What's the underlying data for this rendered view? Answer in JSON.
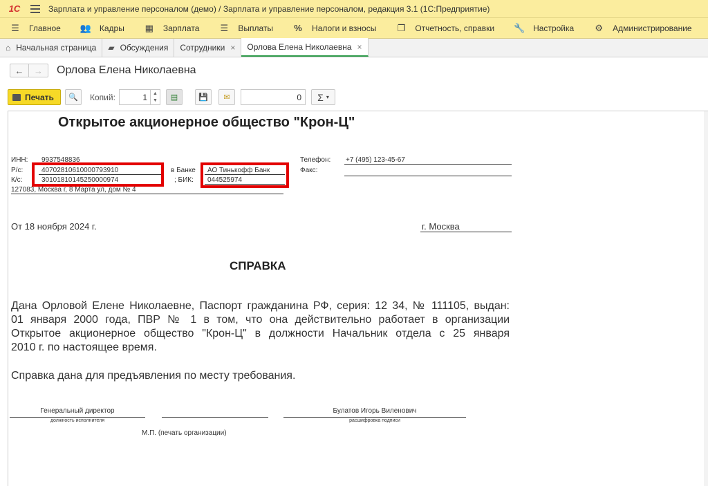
{
  "titlebar": {
    "logo": "1С",
    "title": "Зарплата и управление персоналом (демо) / Зарплата и управление персоналом, редакция 3.1  (1С:Предприятие)"
  },
  "menu": [
    {
      "label": "Главное",
      "icon": "hamburger-icon"
    },
    {
      "label": "Кадры",
      "icon": "people-icon"
    },
    {
      "label": "Зарплата",
      "icon": "calculator-icon"
    },
    {
      "label": "Выплаты",
      "icon": "list-icon"
    },
    {
      "label": "Налоги и взносы",
      "icon": "percent-icon"
    },
    {
      "label": "Отчетность, справки",
      "icon": "documents-icon"
    },
    {
      "label": "Настройка",
      "icon": "wrench-icon"
    },
    {
      "label": "Администрирование",
      "icon": "gear-icon"
    }
  ],
  "tabs": [
    {
      "label": "Начальная страница",
      "icon": "home-icon",
      "closable": false
    },
    {
      "label": "Обсуждения",
      "icon": "chat-icon",
      "closable": false
    },
    {
      "label": "Сотрудники",
      "closable": true
    },
    {
      "label": "Орлова Елена Николаевна",
      "closable": true,
      "active": true
    }
  ],
  "header": {
    "back": "←",
    "forward": "→",
    "title": "Орлова Елена Николаевна"
  },
  "toolbar": {
    "print_label": "Печать",
    "copies_label": "Копий:",
    "copies_value": "1",
    "sum_value": "0",
    "sum_symbol": "Σ",
    "sum_arrow": "▾"
  },
  "doc": {
    "org_title": "Открытое акционерное общество \"Крон-Ц\"",
    "inn_label": "ИНН:",
    "inn": "9937548836",
    "rs_label": "Р/с:",
    "rs": "40702810610000793910",
    "ks_label": "К/с:",
    "ks": "30101810145250000974",
    "bank_label": "в Банке",
    "bank": "АО Тинькофф Банк",
    "bik_label": "; БИК:",
    "bik": "044525974",
    "address": "127083, Москва г, 8 Марта ул, дом № 4",
    "phone_label": "Телефон:",
    "phone": "+7 (495) 123-45-67",
    "fax_label": "Факс:",
    "date": "От 18 ноября 2024 г.",
    "city": "г. Москва",
    "heading": "СПРАВКА",
    "body_line1": "Дана Орловой Елене Николаевне, Паспорт гражданина РФ, серия: 12 34, № 111105, выдан:",
    "body_line2": "01 января 2000 года, ПВР № 1 в том, что она действительно работает в организации",
    "body_line3": "Открытое акционерное общество \"Крон-Ц\" в должности Начальник отдела с 25 января",
    "body_line4": "2010 г. по настоящее время.",
    "body2": "Справка дана для предъявления по месту требования.",
    "sig_position": "Генеральный директор",
    "sig_position_caption": "должность исполнителя",
    "sig_name": "Булатов Игорь Виленович",
    "sig_name_caption": "расшифровка подписи",
    "stamp": "М.П. (печать организации)"
  }
}
